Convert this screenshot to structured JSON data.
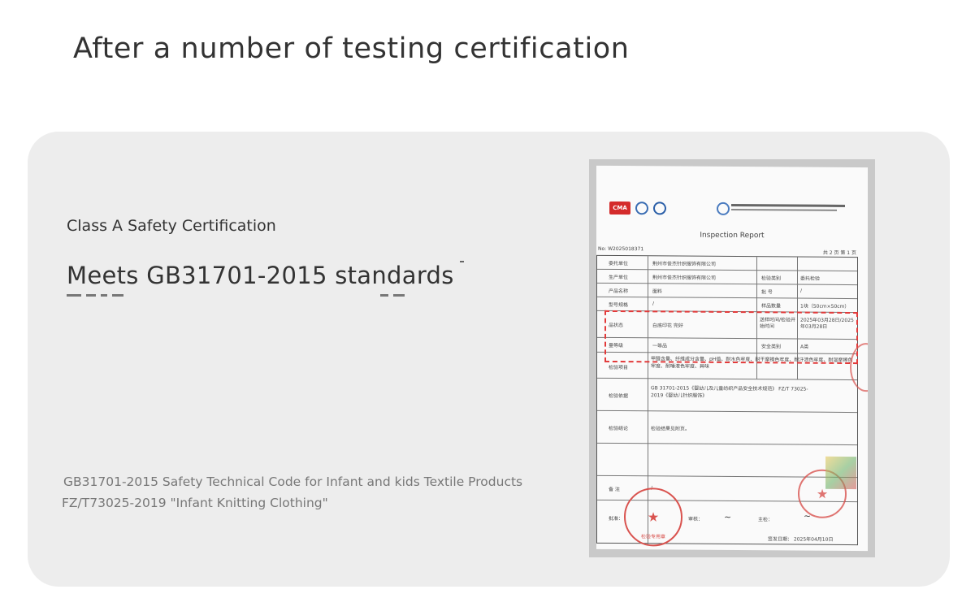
{
  "heading": "After a number of testing certification",
  "panel": {
    "class_label": "Class A Safety Certification",
    "standard": "Meets GB31701-2015 standards",
    "codes": [
      "GB31701-2015 Safety Technical Code for Infant and kids Textile Products",
      "FZ/T73025-2019 \"Infant Knitting Clothing\""
    ]
  },
  "certificate": {
    "title": "Inspection Report",
    "number": "No: W2025018371",
    "page": "共 2 页   第 1 页",
    "rows": [
      {
        "label": "委托单位",
        "value": "荆州市俊杰针织服饰有限公司"
      },
      {
        "label": "生产单位",
        "value": "荆州市俊杰针织服饰有限公司",
        "label2": "检验类别",
        "value2": "委托检验"
      },
      {
        "label": "产品名称",
        "value": "面料",
        "label2": "批    号",
        "value2": "/"
      },
      {
        "label": "型号规格",
        "value": "/",
        "label2": "样品数量",
        "value2": "1块（50cm×50cm）"
      },
      {
        "label": "品状态",
        "value": "白底印花  完好",
        "label2": "送样时间/检验开始时间",
        "value2": "2025年03月28日/2025年03月28日"
      },
      {
        "label": "量等级",
        "value": "一等品",
        "label2": "安全类别",
        "value2": "A类"
      },
      {
        "label": "检验项目",
        "value": "甲醛含量、纤维成分含量、pH值、耐水色牢度、耐干摩擦色牢度、耐汗渍色牢度、耐湿摩擦色牢度、耐唾液色牢度、异味"
      },
      {
        "label": "检验依据",
        "value": "GB 31701-2015《婴幼儿及儿童纺织产品安全技术规范》  FZ/T 73025-2019《婴幼儿针织服饰》"
      },
      {
        "label": "检验结论",
        "value": "检验结果见附页。"
      },
      {
        "label": "备    注",
        "value": "/"
      },
      {
        "label": "批准：",
        "value": "审核：",
        "value2": "主检："
      }
    ],
    "issue_date": "签发日期：  2025年04月10日",
    "stamp_label": "检验专用章"
  }
}
